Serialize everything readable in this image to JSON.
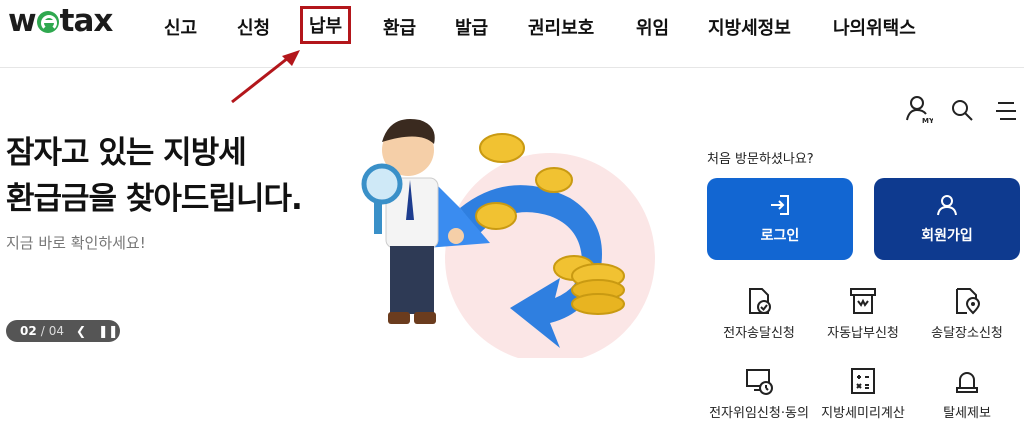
{
  "header": {
    "logo": "wetax",
    "nav": [
      "신고",
      "신청",
      "납부",
      "환급",
      "발급",
      "권리보호",
      "위임",
      "지방세정보",
      "나의위택스"
    ]
  },
  "hero": {
    "title_line1": "잠자고 있는 지방세",
    "title_line2": "환급금을 찾아드립니다.",
    "subtitle": "지금 바로 확인하세요!",
    "pager": {
      "current": "02",
      "separator": "/",
      "total": "04"
    }
  },
  "tools": {
    "my_label": "MY",
    "icons": [
      "user-my-icon",
      "search-icon",
      "menu-icon"
    ]
  },
  "member": {
    "first_visit": "처음 방문하셨나요?",
    "login_label": "로그인",
    "join_label": "회원가입"
  },
  "quick_links": [
    {
      "label": "전자송달신청",
      "icon": "document-check-icon"
    },
    {
      "label": "자동납부신청",
      "icon": "auto-pay-icon"
    },
    {
      "label": "송달장소신청",
      "icon": "location-doc-icon"
    },
    {
      "label": "전자위임신청·동의",
      "icon": "monitor-delegate-icon"
    },
    {
      "label": "지방세미리계산",
      "icon": "calculator-icon"
    },
    {
      "label": "탈세제보",
      "icon": "alarm-light-icon"
    }
  ],
  "colors": {
    "login_bg": "#1266d2",
    "join_bg": "#0e3a8f",
    "highlight_box": "#b3161b",
    "logo_e": "#2fa84f"
  }
}
